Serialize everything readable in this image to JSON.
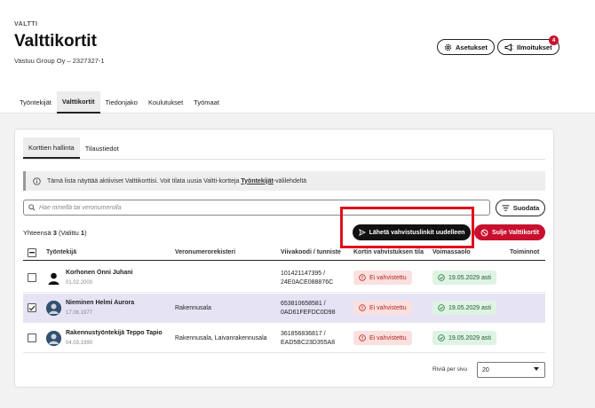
{
  "header": {
    "breadcrumb": "VALTTI",
    "title": "Valttikortit",
    "company": "Vastuu Group Oy – 2327327-1",
    "settings_label": "Asetukset",
    "notifications_label": "Ilmoitukset",
    "notifications_count": "4"
  },
  "tabs": [
    "Työntekijät",
    "Valttikortit",
    "Tiedonjako",
    "Koulutukset",
    "Työmaat"
  ],
  "active_tab": "Valttikortit",
  "subtabs": [
    "Korttien hallinta",
    "Tilaustiedot"
  ],
  "info": {
    "text_before": "Tämä lista näyttää aktiiviset Valttikorttisi. Voit tilata uusia Valtti-kortteja ",
    "link": "Työntekijät",
    "text_after": "-välilehdeltä"
  },
  "search": {
    "placeholder": "Hae nimellä tai veronumerolla"
  },
  "filter_label": "Suodata",
  "summary": {
    "prefix": "Yhteensä ",
    "total": "3",
    "selected_text": " (Valittu ",
    "selected": "1",
    "suffix": ")"
  },
  "actions": {
    "send_label": "Lähetä vahvistuslinkit uudelleen",
    "close_label": "Sulje Valttikortit"
  },
  "table": {
    "columns": [
      "Työntekijä",
      "Veronumerorekisteri",
      "Viivakoodi / tunniste",
      "Kortin vahvistuksen tila",
      "Voimassaolo",
      "Toiminnot"
    ],
    "rows": [
      {
        "name": "Korhonen Onni Juhani",
        "date": "01.02.2000",
        "registry": "",
        "barcode_line1": "101421147395 /",
        "barcode_line2": "24E0ACE088876C",
        "status": "Ei vahvistettu",
        "validity": "19.05.2029 asti",
        "checked": false
      },
      {
        "name": "Nieminen Helmi Aurora",
        "date": "17.06.1977",
        "registry": "Rakennusala",
        "barcode_line1": "653810658581 /",
        "barcode_line2": "0AD61FEFDC0D98",
        "status": "Ei vahvistettu",
        "validity": "19.05.2029 asti",
        "checked": true
      },
      {
        "name": "Rakennustyöntekijä Teppo Tapio",
        "date": "04.03.1990",
        "registry": "Rakennusala, Laivanrakennusala",
        "barcode_line1": "361856836817 /",
        "barcode_line2": "EAD5BC23D355A8",
        "status": "Ei vahvistettu",
        "validity": "19.05.2029 asti",
        "checked": false
      }
    ]
  },
  "pagination": {
    "per_page_label": "Riviä per sivu",
    "per_page_value": "20"
  },
  "colors": {
    "accent_red": "#c8102e",
    "selected_row": "#e6e3f5",
    "highlight_box": "#e0101a"
  }
}
